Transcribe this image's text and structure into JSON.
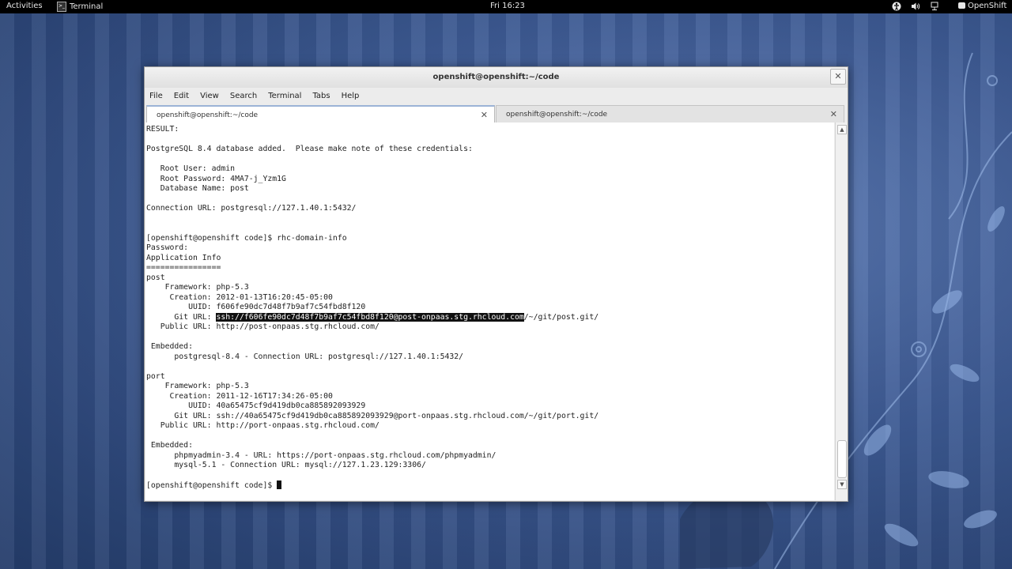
{
  "topbar": {
    "activities": "Activities",
    "app_name": "Terminal",
    "clock": "Fri 16:23",
    "user": "OpenShift",
    "icons": [
      "accessibility-icon",
      "volume-icon",
      "network-icon",
      "user-icon"
    ]
  },
  "window": {
    "title": "openshift@openshift:~/code",
    "close": "✕"
  },
  "menubar": [
    "File",
    "Edit",
    "View",
    "Search",
    "Terminal",
    "Tabs",
    "Help"
  ],
  "tabs": [
    {
      "label": "openshift@openshift:~/code",
      "close": "✕"
    },
    {
      "label": "openshift@openshift:~/code",
      "close": "✕"
    }
  ],
  "terminal": {
    "lines": [
      "RESULT:",
      "",
      "PostgreSQL 8.4 database added.  Please make note of these credentials:",
      "",
      "   Root User: admin",
      "   Root Password: 4MA7-j_Yzm1G",
      "   Database Name: post",
      "",
      "Connection URL: postgresql://127.1.40.1:5432/",
      "",
      "",
      "[openshift@openshift code]$ rhc-domain-info",
      "Password:",
      "Application Info",
      "================",
      "post",
      "    Framework: php-5.3",
      "     Creation: 2012-01-13T16:20:45-05:00",
      "         UUID: f606fe90dc7d48f7b9af7c54fbd8f120",
      "      Git URL: ",
      "   Public URL: http://post-onpaas.stg.rhcloud.com/",
      "",
      " Embedded:",
      "      postgresql-8.4 - Connection URL: postgresql://127.1.40.1:5432/",
      "",
      "port",
      "    Framework: php-5.3",
      "     Creation: 2011-12-16T17:34:26-05:00",
      "         UUID: 40a65475cf9d419db0ca885892093929",
      "      Git URL: ssh://40a65475cf9d419db0ca885892093929@port-onpaas.stg.rhcloud.com/~/git/port.git/",
      "   Public URL: http://port-onpaas.stg.rhcloud.com/",
      "",
      " Embedded:",
      "      phpmyadmin-3.4 - URL: https://port-onpaas.stg.rhcloud.com/phpmyadmin/",
      "      mysql-5.1 - Connection URL: mysql://127.1.23.129:3306/",
      "",
      "[openshift@openshift code]$ "
    ],
    "selected_text": "ssh://f606fe90dc7d48f7b9af7c54fbd8f120@post-onpaas.stg.rhcloud.com",
    "selected_suffix": "/~/git/post.git/"
  }
}
